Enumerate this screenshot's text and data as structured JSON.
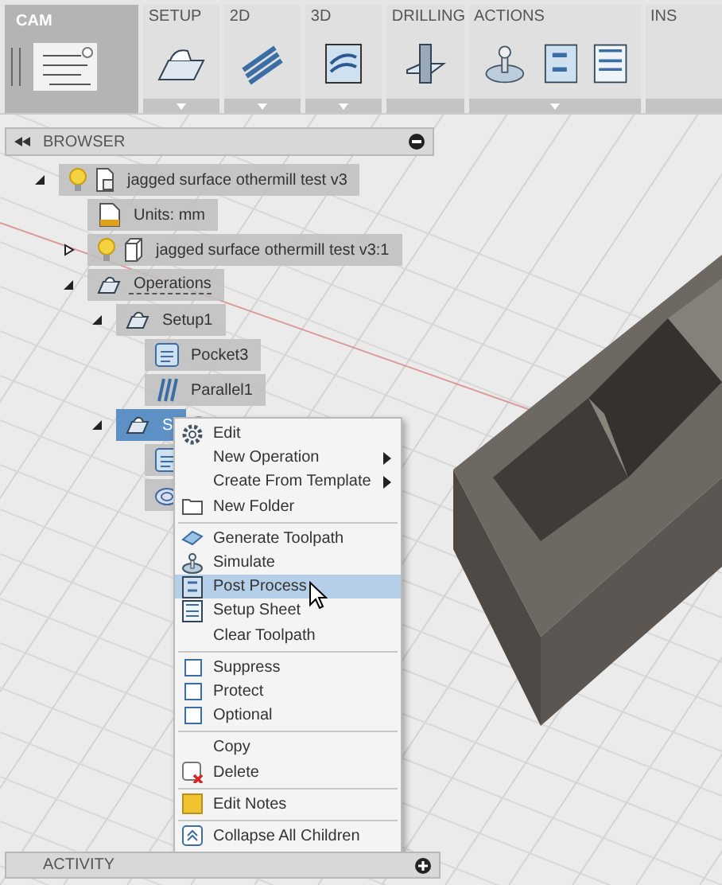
{
  "workspace": {
    "label": "CAM",
    "selected": true
  },
  "toolbar_groups": [
    {
      "label": "SETUP",
      "dropdown": true
    },
    {
      "label": "2D",
      "dropdown": true
    },
    {
      "label": "3D",
      "dropdown": true
    },
    {
      "label": "DRILLING",
      "dropdown": false
    },
    {
      "label": "ACTIONS",
      "dropdown": true
    },
    {
      "label": "INS",
      "dropdown": false
    }
  ],
  "browser": {
    "title": "BROWSER",
    "tree": [
      {
        "label": "jagged surface othermill test v3",
        "kind": "document",
        "expanded": true,
        "selected": false,
        "children": [
          {
            "label": "Units: mm",
            "kind": "units",
            "selected": false
          },
          {
            "label": "jagged surface othermill test v3:1",
            "kind": "component",
            "expanded": false,
            "selected": false
          },
          {
            "label": "Operations",
            "kind": "operations",
            "expanded": true,
            "selected": false,
            "children": [
              {
                "label": "Setup1",
                "kind": "setup",
                "expanded": true,
                "selected": false,
                "children": [
                  {
                    "label": "Pocket3",
                    "kind": "pocket",
                    "selected": false
                  },
                  {
                    "label": "Parallel1",
                    "kind": "parallel",
                    "selected": false
                  }
                ]
              },
              {
                "label": "S",
                "kind": "setup",
                "expanded": true,
                "selected": true,
                "children": [
                  {
                    "kind": "pocket",
                    "selected": false
                  },
                  {
                    "kind": "spiral",
                    "selected": false
                  }
                ]
              }
            ]
          }
        ]
      }
    ]
  },
  "context_menu": [
    [
      {
        "label": "Edit"
      },
      {
        "label": "New Operation",
        "submenu": true
      },
      {
        "label": "Create From Template",
        "submenu": true
      },
      {
        "label": "New Folder"
      }
    ],
    [
      {
        "label": "Generate Toolpath"
      },
      {
        "label": "Simulate"
      },
      {
        "label": "Post Process",
        "selected": true
      },
      {
        "label": "Setup Sheet"
      },
      {
        "label": "Clear Toolpath"
      }
    ],
    [
      {
        "label": "Suppress",
        "checked": false
      },
      {
        "label": "Protect",
        "checked": false
      },
      {
        "label": "Optional",
        "checked": false
      }
    ],
    [
      {
        "label": "Copy"
      },
      {
        "label": "Delete"
      }
    ],
    [
      {
        "label": "Edit Notes"
      }
    ],
    [
      {
        "label": "Collapse All Children"
      }
    ]
  ],
  "activity": {
    "title": "ACTIVITY"
  }
}
